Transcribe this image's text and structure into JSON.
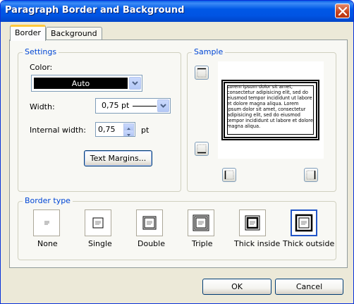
{
  "window": {
    "title": "Paragraph Border and Background",
    "close_icon": "close-icon"
  },
  "tabs": [
    {
      "label": "Border",
      "active": true
    },
    {
      "label": "Background",
      "active": false
    }
  ],
  "settings": {
    "legend": "Settings",
    "color_label": "Color:",
    "color_value": "Auto",
    "width_label": "Width:",
    "width_value": "0,75 pt",
    "internal_width_label": "Internal width:",
    "internal_width_value": "0,75",
    "internal_width_unit": "pt",
    "text_margins_button": "Text Margins..."
  },
  "sample": {
    "legend": "Sample",
    "text": "Lorem ipsum dolor sit amet, consectetur adipisicing elit, sed do eiusmod tempor incididunt ut labore et dolore magna aliqua. Lorem ipsum dolor sit amet, consectetur adipisicing elit, sed do eiusmod tempor incididunt ut labore et dolore magna aliqua."
  },
  "border_type": {
    "legend": "Border type",
    "options": [
      {
        "label": "None",
        "selected": false
      },
      {
        "label": "Single",
        "selected": false
      },
      {
        "label": "Double",
        "selected": false
      },
      {
        "label": "Triple",
        "selected": false
      },
      {
        "label": "Thick inside",
        "selected": false
      },
      {
        "label": "Thick outside",
        "selected": true
      }
    ],
    "selected_color": "#2155c7"
  },
  "buttons": {
    "ok": "OK",
    "cancel": "Cancel"
  }
}
